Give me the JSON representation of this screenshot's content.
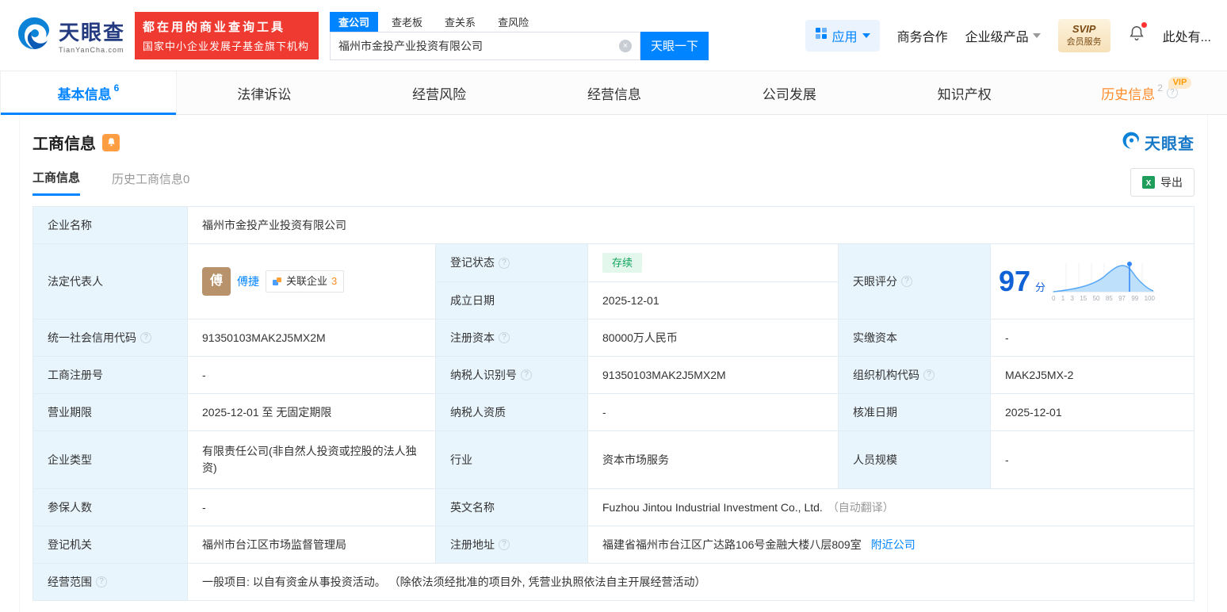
{
  "colors": {
    "accent_blue": "#0084ff",
    "banner_red": "#ee3a30",
    "status_green": "#10a35c",
    "status_green_bg": "#e4f7ec",
    "vip_orange": "#ff8b2a",
    "label_cell_bg": "#e9f5fd",
    "score_blue": "#1061d5"
  },
  "icons": {
    "help": "?",
    "clear": "×",
    "excel": "X"
  },
  "header": {
    "brand": {
      "name": "天眼查",
      "domain": "TianYanCha.com"
    },
    "banner": {
      "line1": "都在用的商业查询工具",
      "line2": "国家中小企业发展子基金旗下机构"
    },
    "search_tabs": [
      {
        "label": "查公司"
      },
      {
        "label": "查老板"
      },
      {
        "label": "查关系"
      },
      {
        "label": "查风险"
      }
    ],
    "search": {
      "value": "福州市金投产业投资有限公司",
      "button_label": "天眼一下"
    },
    "apps_label": "应用",
    "links": [
      {
        "label": "商务合作"
      },
      {
        "label": "企业级产品"
      }
    ],
    "svip": {
      "line1": "SVIP",
      "line2": "会员服务"
    },
    "user_label": "此处有..."
  },
  "nav_tabs": [
    {
      "label": "基本信息",
      "count": "6"
    },
    {
      "label": "法律诉讼"
    },
    {
      "label": "经营风险"
    },
    {
      "label": "经营信息"
    },
    {
      "label": "公司发展"
    },
    {
      "label": "知识产权"
    },
    {
      "label": "历史信息",
      "count": "2",
      "badge": "VIP"
    }
  ],
  "section": {
    "title": "工商信息",
    "watermark_brand": "天眼查",
    "subtabs": [
      {
        "label": "工商信息"
      },
      {
        "label": "历史工商信息0"
      }
    ],
    "export_label": "导出"
  },
  "fields": {
    "company_name": {
      "label": "企业名称",
      "value": "福州市金投产业投资有限公司"
    },
    "legal_rep": {
      "label": "法定代表人",
      "avatar_char": "傅",
      "name": "傅捷",
      "related_label": "关联企业",
      "related_count": "3"
    },
    "reg_status": {
      "label": "登记状态",
      "value": "存续"
    },
    "establish_date": {
      "label": "成立日期",
      "value": "2025-12-01"
    },
    "tyc_score": {
      "label": "天眼评分",
      "score": "97",
      "unit": "分",
      "axis": [
        "0",
        "1",
        "3",
        "15",
        "50",
        "85",
        "97",
        "99",
        "100"
      ]
    },
    "credit_code": {
      "label": "统一社会信用代码",
      "value": "91350103MAK2J5MX2M"
    },
    "reg_capital": {
      "label": "注册资本",
      "value": "80000万人民币"
    },
    "paid_capital": {
      "label": "实缴资本",
      "value": "-"
    },
    "reg_number": {
      "label": "工商注册号",
      "value": "-"
    },
    "taxpayer_id": {
      "label": "纳税人识别号",
      "value": "91350103MAK2J5MX2M"
    },
    "org_code": {
      "label": "组织机构代码",
      "value": "MAK2J5MX-2"
    },
    "business_term": {
      "label": "营业期限",
      "value": "2025-12-01 至 无固定期限"
    },
    "taxpayer_qual": {
      "label": "纳税人资质",
      "value": "-"
    },
    "approval_date": {
      "label": "核准日期",
      "value": "2025-12-01"
    },
    "company_type": {
      "label": "企业类型",
      "value": "有限责任公司(非自然人投资或控股的法人独资)"
    },
    "industry": {
      "label": "行业",
      "value": "资本市场服务"
    },
    "staff_size": {
      "label": "人员规模",
      "value": "-"
    },
    "insured_count": {
      "label": "参保人数",
      "value": "-"
    },
    "english_name": {
      "label": "英文名称",
      "value": "Fuzhou Jintou Industrial Investment Co., Ltd.",
      "note": "（自动翻译）"
    },
    "reg_authority": {
      "label": "登记机关",
      "value": "福州市台江区市场监督管理局"
    },
    "reg_address": {
      "label": "注册地址",
      "value": "福建省福州市台江区广达路106号金融大楼八层809室",
      "link": "附近公司"
    },
    "business_scope": {
      "label": "经营范围",
      "value": "一般项目: 以自有资金从事投资活动。 （除依法须经批准的项目外, 凭营业执照依法自主开展经营活动）"
    }
  }
}
